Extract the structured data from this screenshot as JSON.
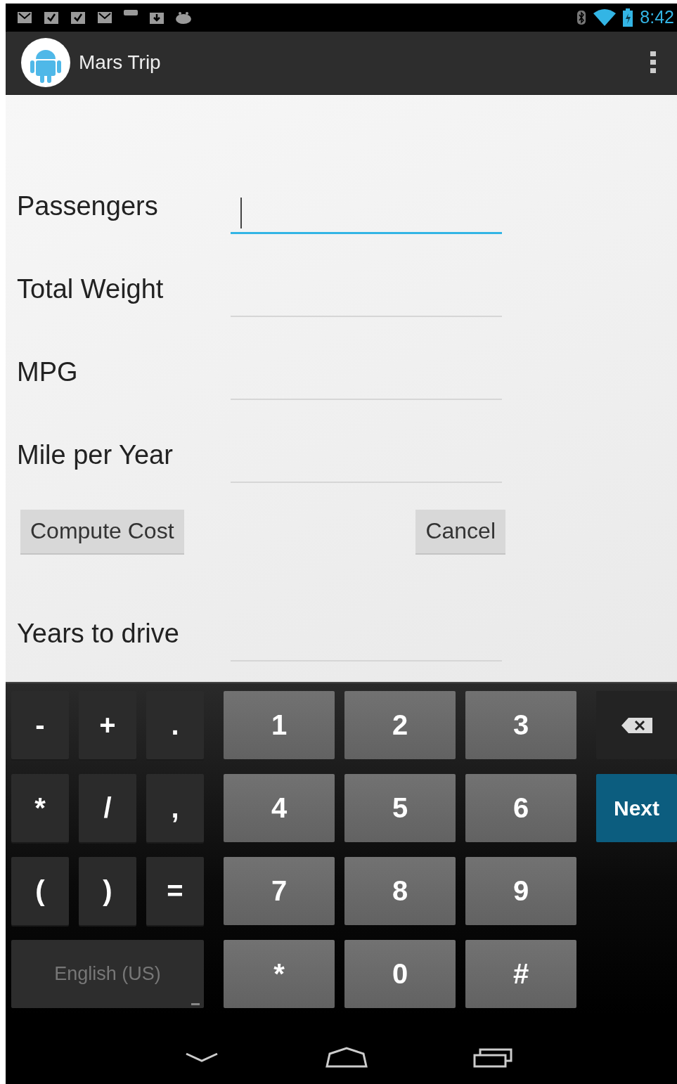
{
  "status_bar": {
    "time": "8:42"
  },
  "app_bar": {
    "title": "Mars Trip"
  },
  "fields": [
    {
      "label": "Passengers",
      "focused": true
    },
    {
      "label": "Total Weight",
      "focused": false
    },
    {
      "label": "MPG",
      "focused": false
    },
    {
      "label": "Mile per Year",
      "focused": false
    }
  ],
  "buttons": [
    {
      "label": "Compute Cost"
    },
    {
      "label": "Cancel"
    }
  ],
  "result_field": {
    "label": "Years to drive",
    "focused": false
  },
  "keyboard": {
    "symbol_keys": [
      "-",
      "+",
      ".",
      "*",
      "/",
      ",",
      "(",
      ")",
      "="
    ],
    "language_key": "English (US)",
    "digit_keys": [
      "1",
      "2",
      "3",
      "4",
      "5",
      "6",
      "7",
      "8",
      "9",
      "*",
      "0",
      "#"
    ],
    "side_keys": [
      {
        "kind": "backspace"
      },
      {
        "kind": "action",
        "label": "Next"
      }
    ]
  }
}
